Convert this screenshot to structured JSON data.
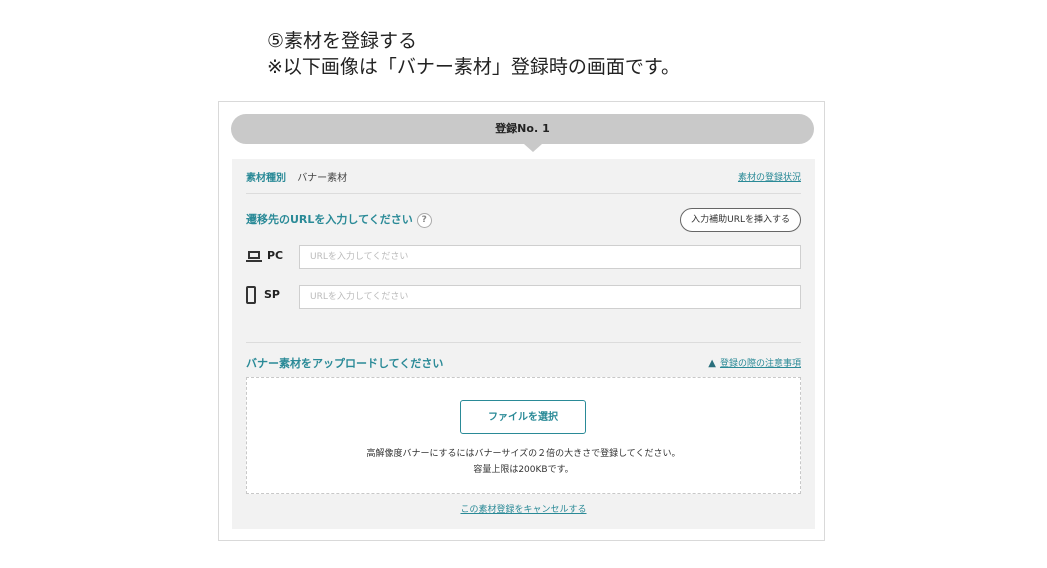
{
  "heading": {
    "line1": "⑤素材を登録する",
    "line2": "※以下画像は「バナー素材」登録時の画面です。"
  },
  "registration": {
    "label": "登録No.",
    "number": "1"
  },
  "material_type": {
    "label": "素材種別",
    "value": "バナー素材",
    "status_link": "素材の登録状況"
  },
  "url_section": {
    "title": "遷移先のURLを入力してください",
    "help_icon": "?",
    "assist_button": "入力補助URLを挿入する",
    "pc": {
      "label": "PC",
      "icon": "laptop-icon",
      "placeholder": "URLを入力してください",
      "value": ""
    },
    "sp": {
      "label": "SP",
      "icon": "smartphone-icon",
      "placeholder": "URLを入力してください",
      "value": ""
    }
  },
  "upload_section": {
    "title": "バナー素材をアップロードしてください",
    "notes_link": "登録の際の注意事項",
    "notes_icon": "warning-icon",
    "file_button": "ファイルを選択",
    "note_line1": "高解像度バナーにするにはバナーサイズの２倍の大きさで登録してください。",
    "note_line2": "容量上限は200KBです。"
  },
  "cancel_link": "この素材登録をキャンセルする",
  "colors": {
    "accent": "#2a8a97",
    "bar": "#c9c9c9",
    "panel_bg": "#f2f2f2"
  }
}
